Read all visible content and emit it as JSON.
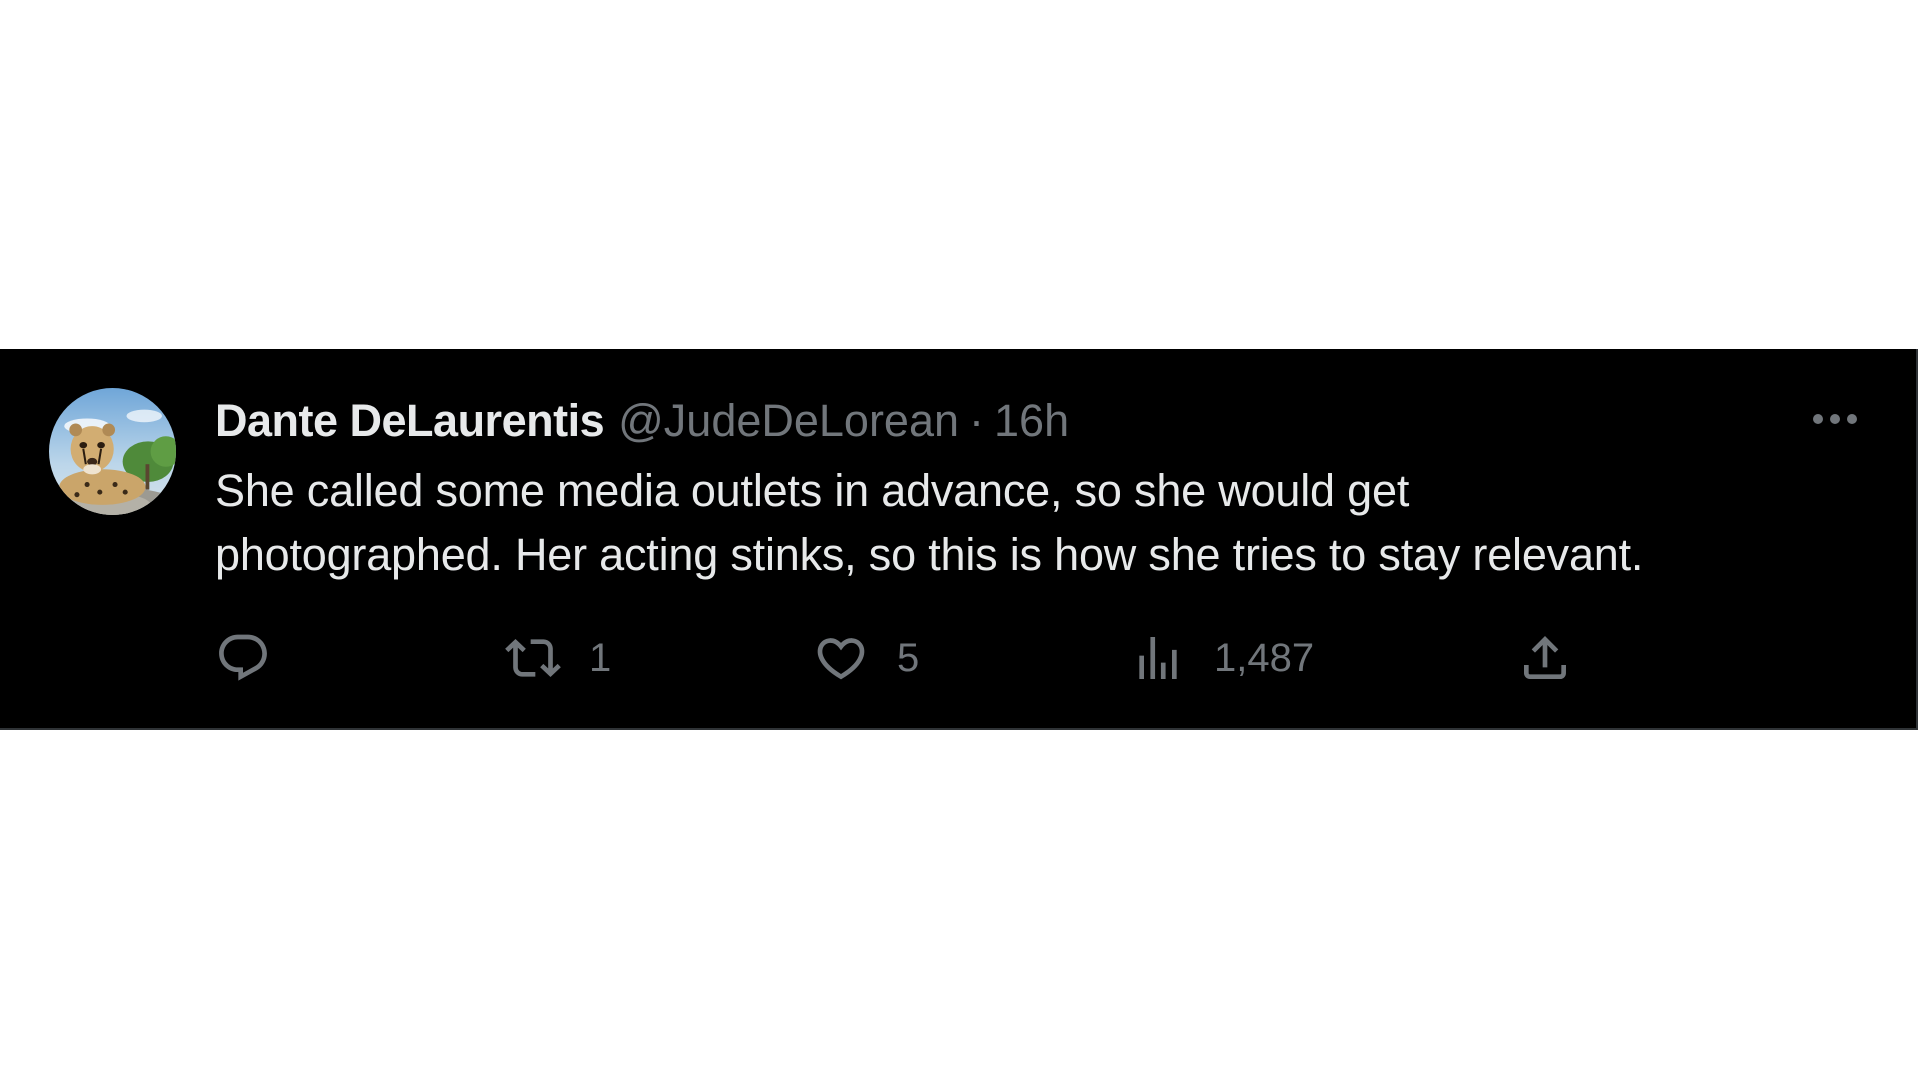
{
  "tweet": {
    "display_name": "Dante DeLaurentis",
    "handle": "@JudeDeLorean",
    "separator": "·",
    "time": "16h",
    "text": "She called some media outlets in advance, so she would get\nphotographed.  Her acting stinks, so this is how she tries to stay relevant."
  },
  "avatar": {
    "description_icon": "cheetah-avatar"
  },
  "actions": {
    "reply": {
      "icon": "reply-icon"
    },
    "retweet": {
      "icon": "retweet-icon",
      "count": "1"
    },
    "like": {
      "icon": "heart-icon",
      "count": "5"
    },
    "views": {
      "icon": "views-chart-icon",
      "count": "1,487"
    },
    "share": {
      "icon": "share-icon"
    },
    "more": {
      "icon": "more-dots-icon"
    }
  },
  "colors": {
    "background": "#000000",
    "primary_text": "#e7e9ea",
    "secondary_text": "#71767b",
    "page": "#ffffff"
  }
}
